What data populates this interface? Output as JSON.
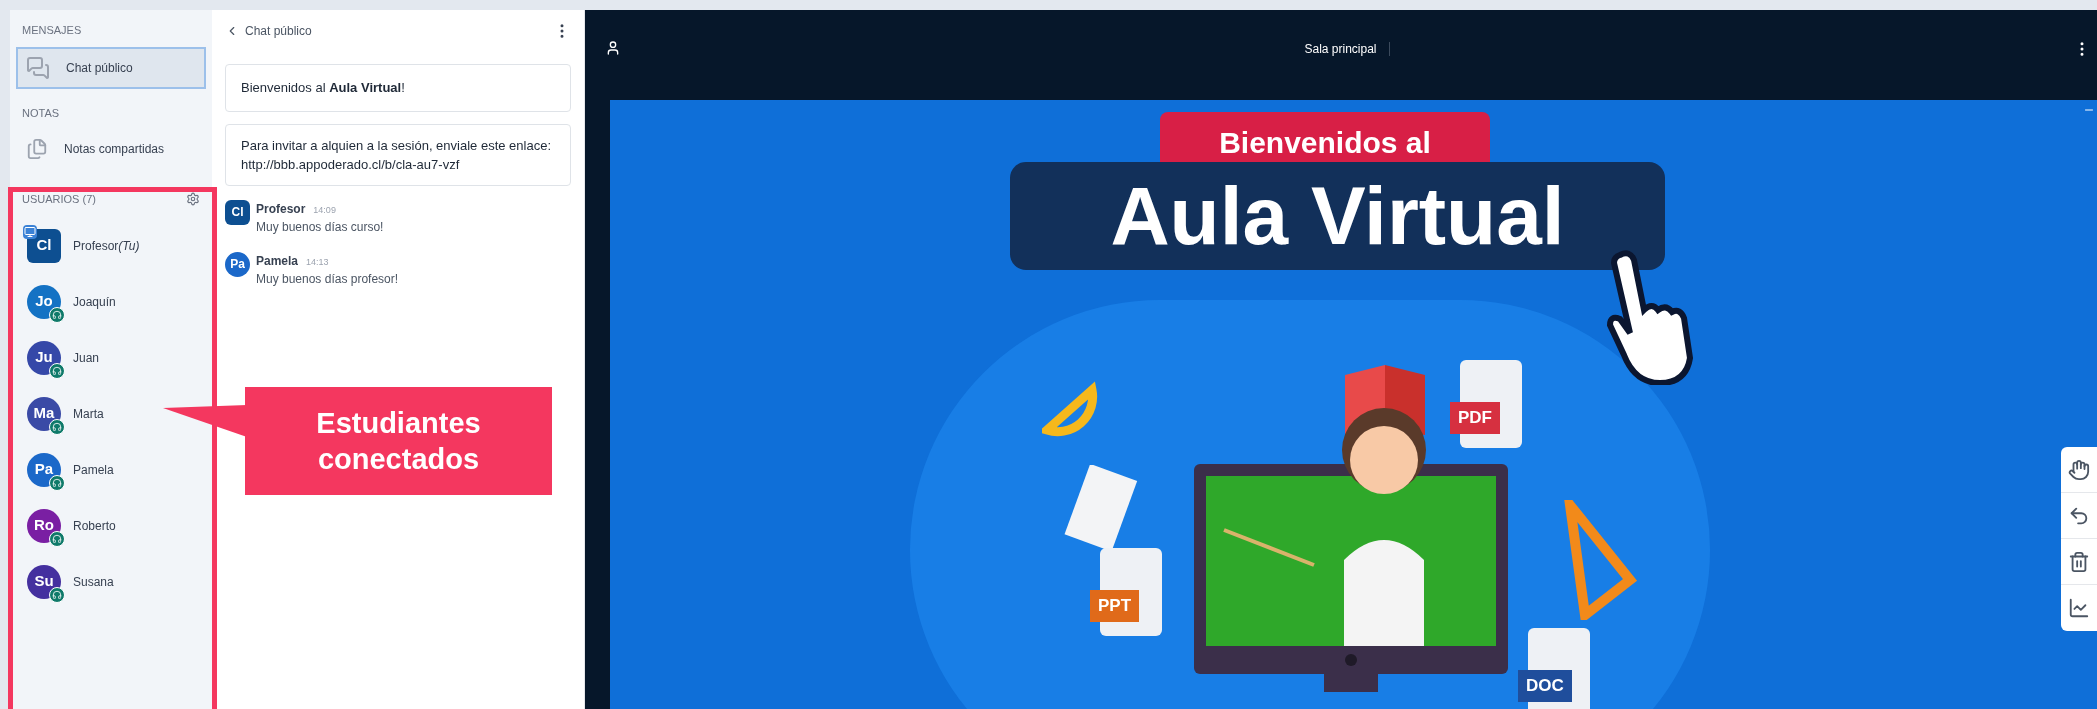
{
  "sidebar": {
    "messages_heading": "MENSAJES",
    "public_chat": {
      "label": "Chat público",
      "selected": true
    },
    "notes_heading": "NOTAS",
    "shared_notes": {
      "label": "Notas compartidas",
      "selected": false
    },
    "users_heading": "USUARIOS (7)",
    "users": [
      {
        "initials": "Cl",
        "name": "Profesor",
        "you_label": "(Tu)",
        "kind": "moderator",
        "presenter": true,
        "listen_only": false,
        "color": "#0d4f91"
      },
      {
        "initials": "Jo",
        "name": "Joaquín",
        "kind": "viewer",
        "presenter": false,
        "listen_only": true,
        "color": "#1472c4"
      },
      {
        "initials": "Ju",
        "name": "Juan",
        "kind": "viewer",
        "presenter": false,
        "listen_only": true,
        "color": "#3548a8"
      },
      {
        "initials": "Ma",
        "name": "Marta",
        "kind": "viewer",
        "presenter": false,
        "listen_only": true,
        "color": "#3a4aa6"
      },
      {
        "initials": "Pa",
        "name": "Pamela",
        "kind": "viewer",
        "presenter": false,
        "listen_only": true,
        "color": "#1b68c9"
      },
      {
        "initials": "Ro",
        "name": "Roberto",
        "kind": "viewer",
        "presenter": false,
        "listen_only": true,
        "color": "#7a1fa3"
      },
      {
        "initials": "Su",
        "name": "Susana",
        "kind": "viewer",
        "presenter": false,
        "listen_only": true,
        "color": "#44309f"
      }
    ]
  },
  "chat": {
    "title": "Chat público",
    "welcome": "Bienvenidos al **Aula Virtual**!",
    "invite": "Para invitar a alquien a la sesión, enviale este enlace: http://bbb.appoderado.cl/b/cla-au7-vzf",
    "messages": [
      {
        "initials": "Cl",
        "kind": "moderator",
        "color": "#0d4f91",
        "name": "Profesor",
        "time": "14:09",
        "text": "Muy buenos días curso!"
      },
      {
        "initials": "Pa",
        "kind": "viewer",
        "color": "#1b68c9",
        "name": "Pamela",
        "time": "14:13",
        "text": "Muy buenos días profesor!"
      }
    ]
  },
  "room": {
    "title": "Sala principal"
  },
  "slide": {
    "subtitle": "Bienvenidos al",
    "title": "Aula Virtual",
    "files": [
      {
        "label": "PDF",
        "color": "#d63040"
      },
      {
        "label": "PPT",
        "color": "#e06a1a"
      },
      {
        "label": "DOC",
        "color": "#1f4e9c"
      }
    ]
  },
  "annotation": {
    "text": "Estudiantes conectados"
  }
}
